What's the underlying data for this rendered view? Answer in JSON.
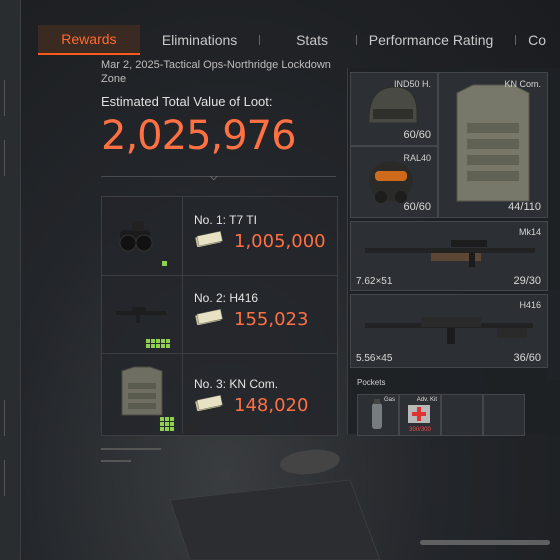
{
  "tabs": [
    {
      "label": "Rewards",
      "active": true
    },
    {
      "label": "Eliminations",
      "active": false
    },
    {
      "label": "Stats",
      "active": false
    },
    {
      "label": "Performance Rating",
      "active": false
    },
    {
      "label": "Co",
      "active": false
    }
  ],
  "header": {
    "match_info": "Mar 2, 2025-Tactical Ops-Northridge Lockdown Zone",
    "estimated_label": "Estimated Total Value of Loot:",
    "total_value": "2,025,976"
  },
  "loot": [
    {
      "name": "No. 1: T7 TI",
      "value": "1,005,000",
      "icon": "night-vision-goggles",
      "size": [
        1,
        1
      ]
    },
    {
      "name": "No. 2: H416",
      "value": "155,023",
      "icon": "assault-rifle",
      "size": [
        2,
        5
      ]
    },
    {
      "name": "No. 3: KN Com.",
      "value": "148,020",
      "icon": "body-armor",
      "size": [
        3,
        3
      ]
    }
  ],
  "gear": {
    "helmet": {
      "label": "IND50 H.",
      "count": "60/60",
      "icon": "helmet"
    },
    "mask": {
      "label": "RAL40",
      "count": "60/60",
      "icon": "gas-mask"
    },
    "armor": {
      "label": "KN Com.",
      "count": "44/110",
      "icon": "body-armor"
    },
    "primary": {
      "label": "Mk14",
      "caliber": "7.62×51",
      "ammo": "29/30",
      "icon": "marksman-rifle"
    },
    "secondary": {
      "label": "H416",
      "caliber": "5.56×45",
      "ammo": "36/60",
      "icon": "assault-rifle"
    }
  },
  "pockets": {
    "label": "Pockets",
    "items": [
      {
        "label": "Gas",
        "count": "",
        "icon": "gas-canister"
      },
      {
        "label": "Adv. Kit",
        "count": "300/300",
        "icon": "medical-kit"
      },
      {
        "label": "",
        "count": "",
        "icon": ""
      },
      {
        "label": "",
        "count": "",
        "icon": ""
      }
    ]
  },
  "colors": {
    "accent": "#ff6a2f",
    "value": "#ff7043",
    "grid": "#8fd14f"
  }
}
